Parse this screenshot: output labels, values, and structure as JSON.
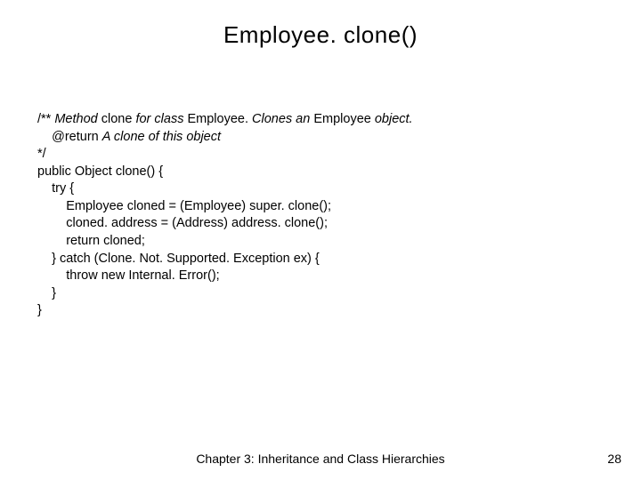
{
  "title": "Employee. clone()",
  "code": {
    "l1a": "/** ",
    "l1b": "Method ",
    "l1c": "clone ",
    "l1d": "for class ",
    "l1e": "Employee. ",
    "l1f": "Clones an ",
    "l1g": "Employee ",
    "l1h": "object.",
    "l2a": "    @return ",
    "l2b": "A clone of this object",
    "l3": "*/",
    "l4": "public Object clone() {",
    "l5": "    try {",
    "l6": "        Employee cloned = (Employee) super. clone();",
    "l7": "        cloned. address = (Address) address. clone();",
    "l8": "        return cloned;",
    "l9": "    } catch (Clone. Not. Supported. Exception ex) {",
    "l10": "        throw new Internal. Error();",
    "l11": "    }",
    "l12": "}"
  },
  "footer": "Chapter 3: Inheritance and Class Hierarchies",
  "page": "28"
}
